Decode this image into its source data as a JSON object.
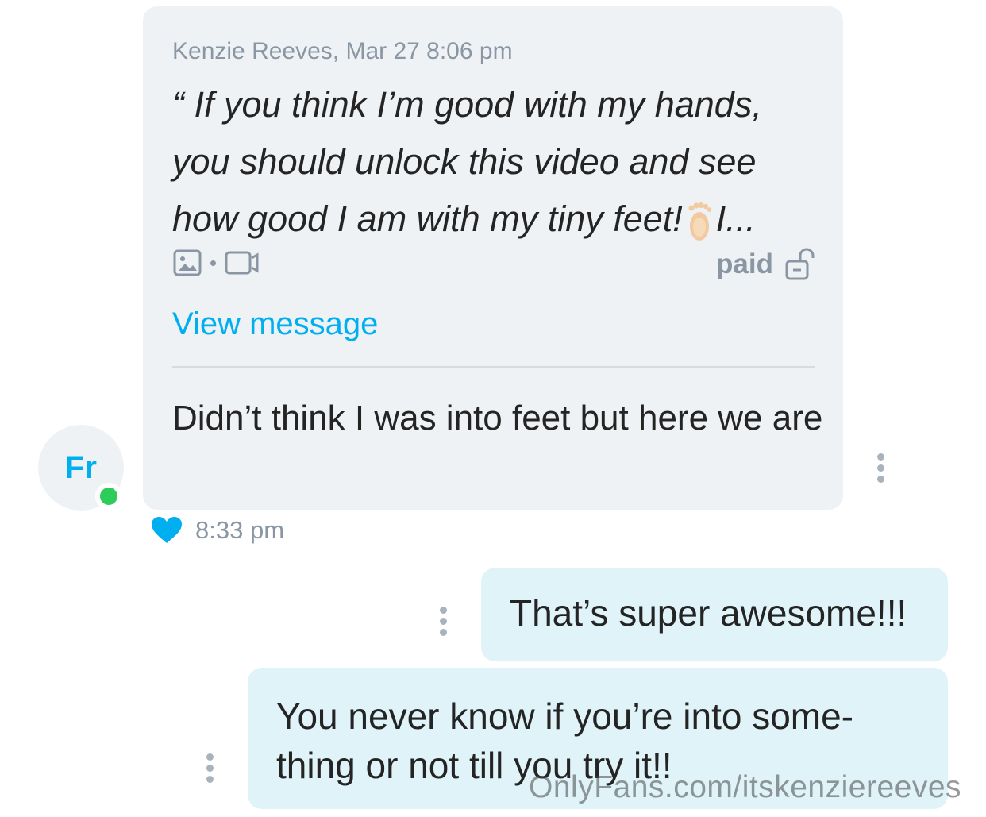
{
  "incoming": {
    "quote_meta": "Kenzie Reeves, Mar 27 8:06 pm",
    "quote_text_before_emoji": "“ If you think I’m good with my hands,\nyou should unlock this video and see\nhow good I am with my tiny feet!",
    "quote_text_after_emoji": "I...",
    "emoji_icon": "foot-emoji",
    "media_icons": [
      "image-icon",
      "video-icon"
    ],
    "paid_label": "paid",
    "paid_icon": "unlocked-padlock-icon",
    "view_link": "View message",
    "reply_text": "Didn’t think I was into feet but here we are",
    "time": "8:33 pm",
    "liked": true
  },
  "avatar": {
    "initials": "Fr",
    "online": true,
    "online_color": "#2ecc5a"
  },
  "outgoing": [
    {
      "text": "That’s super awesome!!!"
    },
    {
      "text": "You never know if you’re into some-thing or not till you try it!!"
    }
  ],
  "watermark": "OnlyFans.com/itskenziereeves",
  "colors": {
    "accent": "#00aff0",
    "incoming_bubble": "#eff2f4",
    "outgoing_bubble": "#dff3f9",
    "meta_text": "#8a96a3"
  }
}
